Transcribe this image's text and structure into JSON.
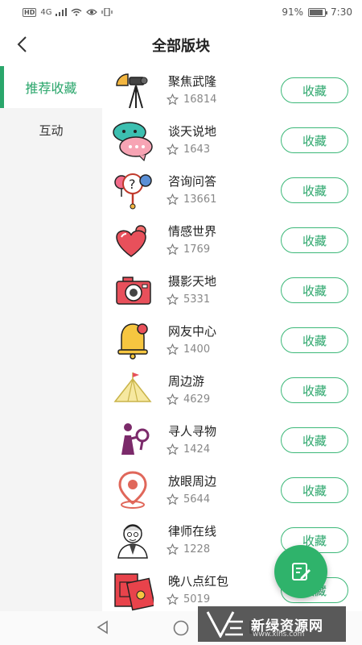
{
  "statusbar": {
    "network": "4G",
    "battery": "91%",
    "battery_level": 0.91,
    "time": "7:30"
  },
  "header": {
    "title": "全部版块"
  },
  "sidebar": {
    "items": [
      {
        "label": "推荐收藏"
      },
      {
        "label": "互动"
      }
    ]
  },
  "forums": [
    {
      "name": "聚焦武隆",
      "count": "16814",
      "icon": "camera-tripod-icon",
      "button": "收藏"
    },
    {
      "name": "谈天说地",
      "count": "1643",
      "icon": "chat-bubbles-icon",
      "button": "收藏"
    },
    {
      "name": "咨询问答",
      "count": "13661",
      "icon": "question-gender-icon",
      "button": "收藏"
    },
    {
      "name": "情感世界",
      "count": "1769",
      "icon": "hearts-icon",
      "button": "收藏"
    },
    {
      "name": "摄影天地",
      "count": "5331",
      "icon": "camera-icon",
      "button": "收藏"
    },
    {
      "name": "网友中心",
      "count": "1400",
      "icon": "bell-icon",
      "button": "收藏"
    },
    {
      "name": "周边游",
      "count": "4629",
      "icon": "tent-icon",
      "button": "收藏"
    },
    {
      "name": "寻人寻物",
      "count": "1424",
      "icon": "person-search-icon",
      "button": "收藏"
    },
    {
      "name": "放眼周边",
      "count": "5644",
      "icon": "map-pin-icon",
      "button": "收藏"
    },
    {
      "name": "律师在线",
      "count": "1228",
      "icon": "lawyer-icon",
      "button": "收藏"
    },
    {
      "name": "晚八点红包",
      "count": "5019",
      "icon": "red-envelope-icon",
      "button": "收藏"
    }
  ],
  "watermark": {
    "title": "新绿资源网",
    "url": "www.xlhs.com"
  },
  "colors": {
    "accent": "#2aa66b",
    "sidebar_bg": "#f4f4f4"
  }
}
